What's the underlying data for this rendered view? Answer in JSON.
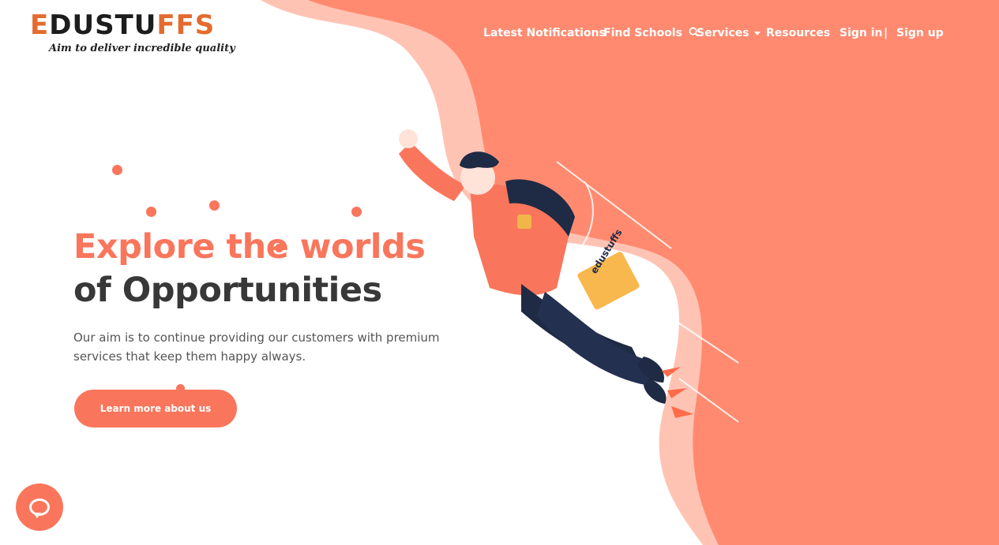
{
  "brand": {
    "logo_text_start": "E",
    "logo_text_mid": "DUSTU",
    "logo_text_end": "FFS",
    "tagline": "Aim to deliver incredible quality"
  },
  "nav": {
    "latest_notifications": "Latest Notifications",
    "find_schools": "Find Schools",
    "services": "Services",
    "resources": "Resources",
    "sign_in": "Sign in",
    "separator": "|",
    "sign_up": "Sign up"
  },
  "hero": {
    "title_line1": "Explore the worlds",
    "title_line2": "of Opportunities",
    "description": "Our aim is to continue providing our customers with premium services that keep them happy always.",
    "cta_label": "Learn more about us"
  },
  "illustration": {
    "book_label": "edustuffs"
  },
  "colors": {
    "accent": "#f9765c",
    "wave": "#ff8a70",
    "wave_light": "#ffc3b4",
    "dark_text": "#383838"
  }
}
